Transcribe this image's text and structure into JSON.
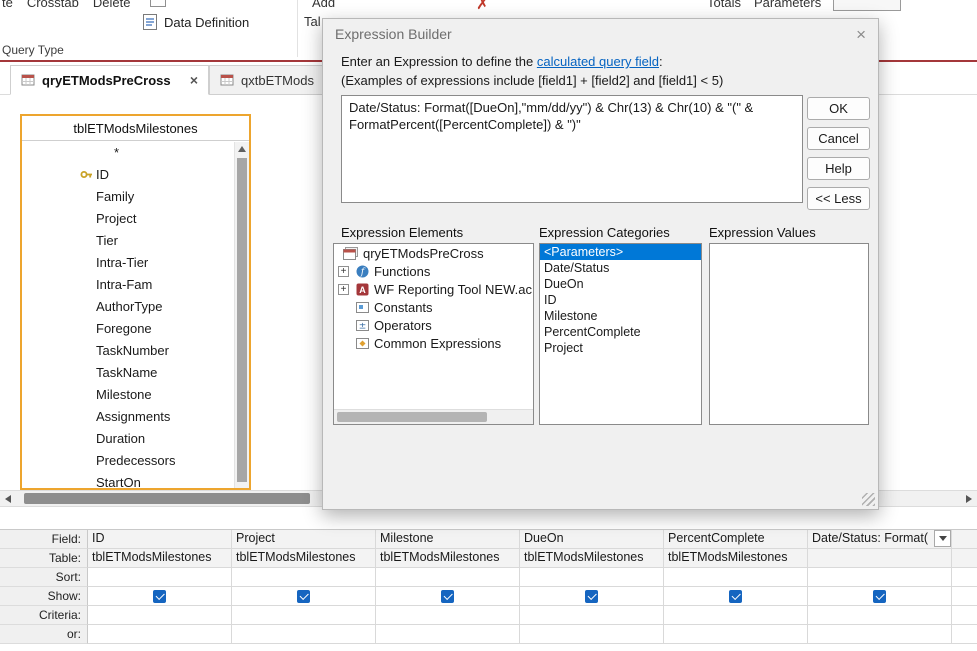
{
  "colors": {
    "accent": "#A4373A",
    "selection": "#0078D7",
    "link": "#0563C1",
    "checkbox": "#1565C0",
    "table_border": "#EDA52E"
  },
  "icons": {
    "close": "×"
  },
  "ribbon": {
    "query_type_fragments": [
      "te",
      "Crosstab",
      "Delete"
    ],
    "data_definition_label": "Data Definition",
    "group_label": "Query Type",
    "add_fragment": "Add",
    "tables_fragment": "Tal",
    "totals_label": "Totals",
    "parameters_label": "Parameters"
  },
  "tabs": [
    {
      "label": "qryETModsPreCross"
    },
    {
      "label": "qxtbETMods"
    }
  ],
  "field_list": {
    "title": "tblETModsMilestones",
    "fields": [
      "*",
      "ID",
      "Family",
      "Project",
      "Tier",
      "Intra-Tier",
      "Intra-Fam",
      "AuthorType",
      "Foregone",
      "TaskNumber",
      "TaskName",
      "Milestone",
      "Assignments",
      "Duration",
      "Predecessors",
      "StartOn"
    ]
  },
  "dialog": {
    "title": "Expression Builder",
    "instruction_prefix": "Enter an Expression to define the ",
    "instruction_link": "calculated query field",
    "instruction_suffix": ":",
    "examples_line": "(Examples of expressions include [field1] + [field2] and [field1] < 5)",
    "expression_text": "Date/Status: Format([DueOn],\"mm/dd/yy\") & Chr(13) & Chr(10) & \"(\" & FormatPercent([PercentComplete]) & \")\"",
    "buttons": {
      "ok": "OK",
      "cancel": "Cancel",
      "help": "Help",
      "less": "<< Less"
    },
    "panels": {
      "elements_label": "Expression Elements",
      "categories_label": "Expression Categories",
      "values_label": "Expression Values",
      "elements": [
        {
          "label": "qryETModsPreCross"
        },
        {
          "label": "Functions"
        },
        {
          "label": "WF Reporting Tool NEW.ac"
        },
        {
          "label": "Constants"
        },
        {
          "label": "Operators"
        },
        {
          "label": "Common Expressions"
        }
      ],
      "categories": [
        "<Parameters>",
        "Date/Status",
        "DueOn",
        "ID",
        "Milestone",
        "PercentComplete",
        "Project"
      ],
      "selected_category": "<Parameters>"
    }
  },
  "grid": {
    "row_labels": [
      "Field:",
      "Table:",
      "Sort:",
      "Show:",
      "Criteria:",
      "or:"
    ],
    "columns": [
      {
        "field": "ID",
        "table": "tblETModsMilestones",
        "show": true
      },
      {
        "field": "Project",
        "table": "tblETModsMilestones",
        "show": true
      },
      {
        "field": "Milestone",
        "table": "tblETModsMilestones",
        "show": true
      },
      {
        "field": "DueOn",
        "table": "tblETModsMilestones",
        "show": true
      },
      {
        "field": "PercentComplete",
        "table": "tblETModsMilestones",
        "show": true
      },
      {
        "field": "Date/Status: Format(",
        "table": "",
        "show": true
      }
    ]
  }
}
